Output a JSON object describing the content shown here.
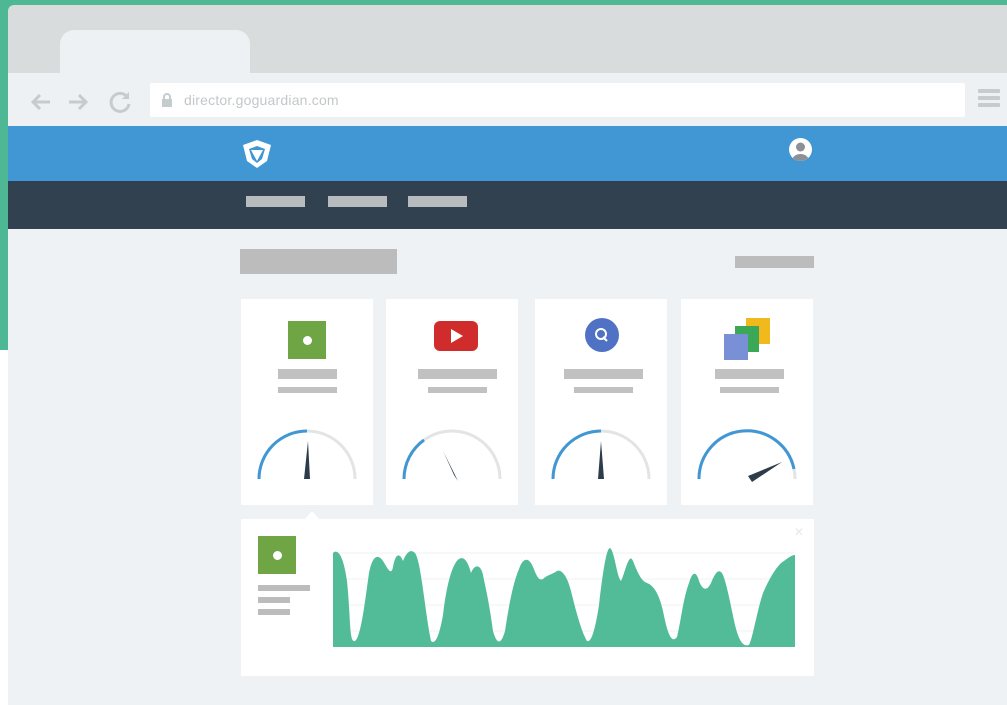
{
  "browser": {
    "url": "director.goguardian.com",
    "icons": [
      "back-arrow-icon",
      "forward-arrow-icon",
      "reload-icon",
      "lock-icon",
      "hamburger-menu-icon"
    ]
  },
  "app": {
    "header_color": "#4097d4",
    "subnav_color": "#324150",
    "accent_green": "#52bc98",
    "icons": [
      "goguardian-shield-icon",
      "user-avatar-icon"
    ]
  },
  "cards": [
    {
      "icon": "green-square-app-icon",
      "gauge_level": 0.5
    },
    {
      "icon": "youtube-icon",
      "gauge_level": 0.28
    },
    {
      "icon": "quizlet-icon",
      "gauge_level": 0.5
    },
    {
      "icon": "google-docs-stack-icon",
      "gauge_level": 0.9
    }
  ],
  "detail": {
    "icon": "green-square-app-icon",
    "close_icon": "close-icon"
  }
}
